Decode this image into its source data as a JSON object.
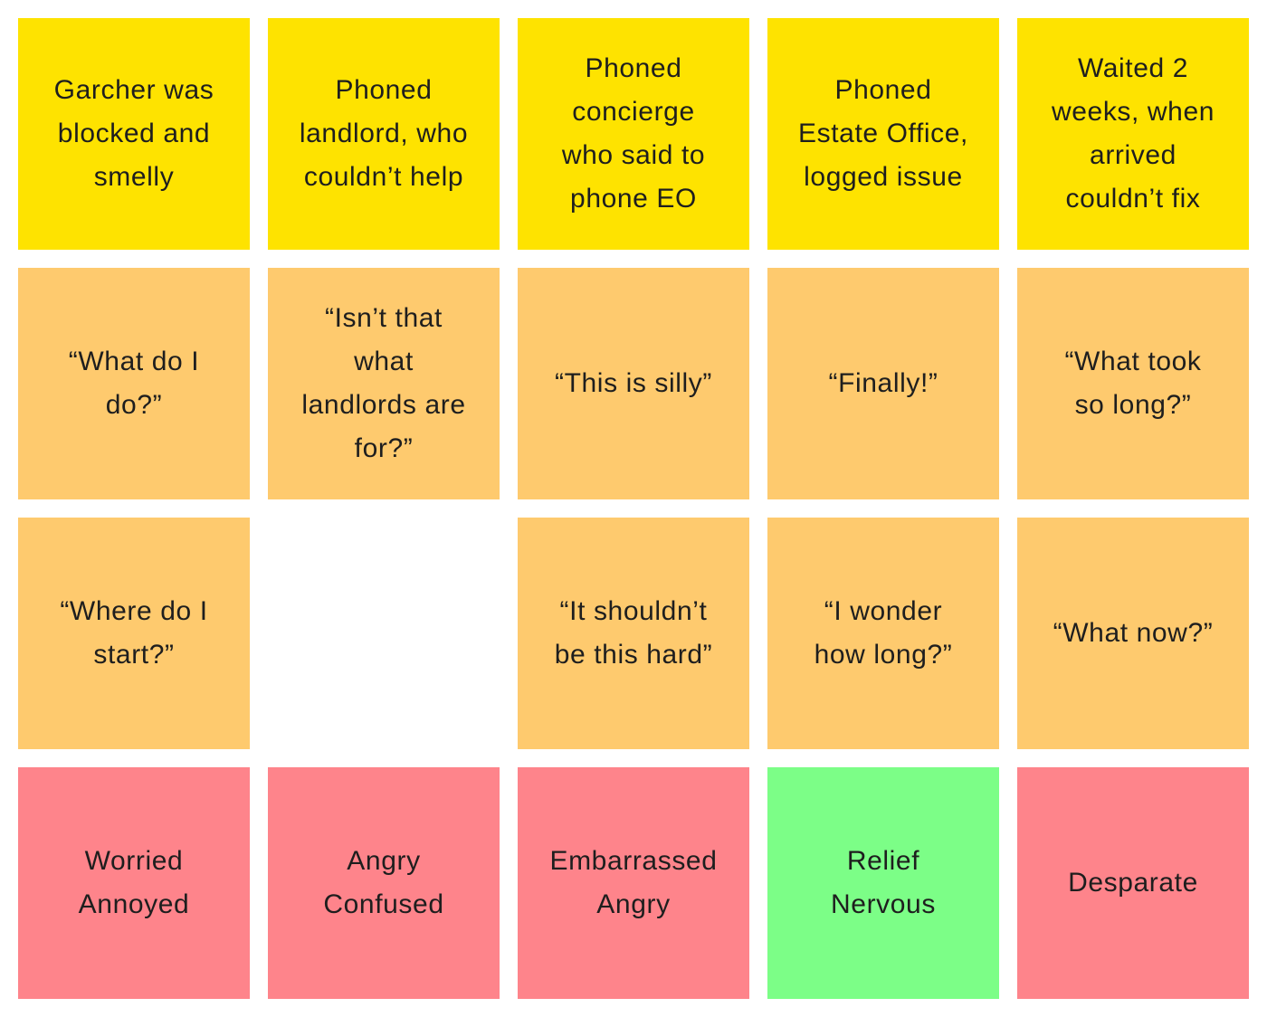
{
  "colors": {
    "yellow": "#FEE300",
    "orange": "#FECA6E",
    "red": "#FE848B",
    "green": "#7CFE87"
  },
  "rows": [
    {
      "name": "actions",
      "notes": [
        {
          "text": "Garcher was\nblocked and\nsmelly",
          "color": "yellow"
        },
        {
          "text": "Phoned\nlandlord, who\ncouldn’t help",
          "color": "yellow"
        },
        {
          "text": "Phoned\nconcierge\nwho said to\nphone EO",
          "color": "yellow"
        },
        {
          "text": "Phoned\nEstate Office,\nlogged issue",
          "color": "yellow"
        },
        {
          "text": "Waited 2\nweeks, when\narrived\ncouldn’t fix",
          "color": "yellow"
        }
      ]
    },
    {
      "name": "thoughts-1",
      "notes": [
        {
          "text": "“What do I\ndo?”",
          "color": "orange"
        },
        {
          "text": "“Isn’t that\nwhat\nlandlords are\nfor?”",
          "color": "orange"
        },
        {
          "text": "“This is silly”",
          "color": "orange"
        },
        {
          "text": "“Finally!”",
          "color": "orange"
        },
        {
          "text": "“What took\nso long?”",
          "color": "orange"
        }
      ]
    },
    {
      "name": "thoughts-2",
      "notes": [
        {
          "text": "“Where do I\nstart?”",
          "color": "orange"
        },
        null,
        {
          "text": "“It shouldn’t\nbe this hard”",
          "color": "orange"
        },
        {
          "text": "“I wonder\nhow long?”",
          "color": "orange"
        },
        {
          "text": "“What now?”",
          "color": "orange"
        }
      ]
    },
    {
      "name": "feelings",
      "notes": [
        {
          "text": "Worried\nAnnoyed",
          "color": "red"
        },
        {
          "text": "Angry\nConfused",
          "color": "red"
        },
        {
          "text": "Embarrassed\nAngry",
          "color": "red"
        },
        {
          "text": "Relief\nNervous",
          "color": "green"
        },
        {
          "text": "Desparate",
          "color": "red"
        }
      ]
    }
  ]
}
